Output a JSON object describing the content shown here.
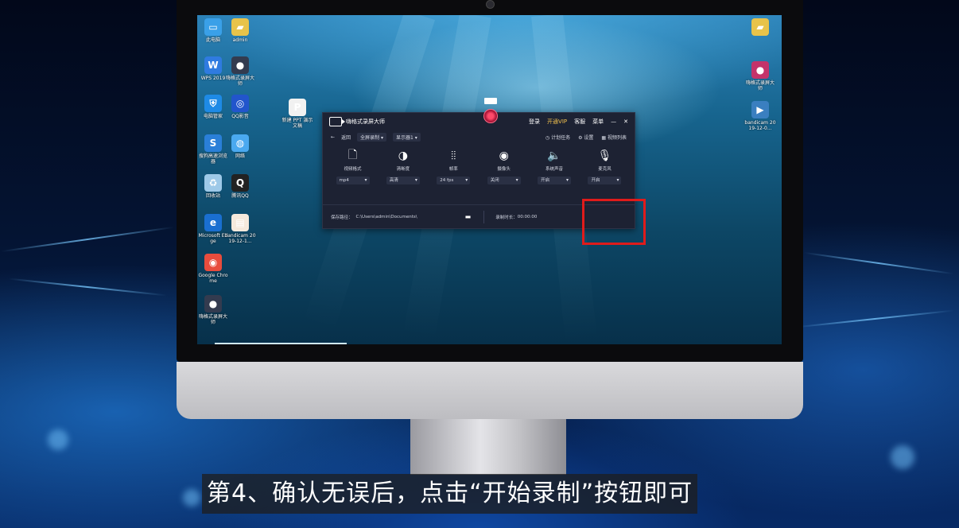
{
  "desktop_icons": [
    {
      "label": "此电脑",
      "icon": "computer-icon",
      "color": "#3aa0e8"
    },
    {
      "label": "admin",
      "icon": "user-folder-icon",
      "color": "#e8c34a"
    },
    {
      "label": "WPS 2019",
      "icon": "wps-icon",
      "color": "#2f7be0"
    },
    {
      "label": "嗨格式录屏大师",
      "icon": "recorder-icon",
      "color": "#333b4f"
    },
    {
      "label": "电脑管家",
      "icon": "shield-icon",
      "color": "#1e8ae6"
    },
    {
      "label": "QQ影音",
      "icon": "media-player-icon",
      "color": "#2255cc"
    },
    {
      "label": "新建 PPT 演示文稿",
      "icon": "ppt-file-icon",
      "color": "#f1f1f1"
    },
    {
      "label": "搜狗高速浏览器",
      "icon": "browser-icon",
      "color": "#2a7fd8"
    },
    {
      "label": "网络",
      "icon": "network-icon",
      "color": "#4aa9f0"
    },
    {
      "label": "回收站",
      "icon": "recycle-bin-icon",
      "color": "#9ec9e8"
    },
    {
      "label": "腾讯QQ",
      "icon": "qq-icon",
      "color": "#222"
    },
    {
      "label": "Microsoft Edge",
      "icon": "edge-icon",
      "color": "#1a6fd0"
    },
    {
      "label": "bandicam 2019-12-1...",
      "icon": "image-file-icon",
      "color": "#f5e9dc"
    },
    {
      "label": "Google Chrome",
      "icon": "chrome-icon",
      "color": "#e84c3d"
    },
    {
      "label": "嗨格式录屏大师",
      "icon": "recorder-icon",
      "color": "#333b4f"
    },
    {
      "label": "",
      "icon": "folder-icon",
      "color": "#e8c34a"
    },
    {
      "label": "嗨格式录屏大师",
      "icon": "recorder-icon",
      "color": "#c4336a"
    },
    {
      "label": "bandicam 2019-12-0...",
      "icon": "video-file-icon",
      "color": "#3a7fc0"
    }
  ],
  "app": {
    "title": "嗨格式录屏大师",
    "login": "登录",
    "vip": "开通VIP",
    "service": "客服",
    "menu": "菜单",
    "minimize": "—",
    "close": "✕",
    "back": "返回",
    "mode": "全屏录制",
    "display": "显示器1",
    "schedule": "计划任务",
    "settings": "设置",
    "video_list": "视频列表",
    "features": [
      {
        "label": "视频格式",
        "value": "mp4",
        "icon": "file-icon"
      },
      {
        "label": "清晰度",
        "value": "高清",
        "icon": "contrast-icon"
      },
      {
        "label": "帧率",
        "value": "24 fps",
        "icon": "waveform-icon"
      },
      {
        "label": "摄像头",
        "value": "关闭",
        "icon": "camera-icon"
      },
      {
        "label": "系统声音",
        "value": "开启",
        "icon": "speaker-icon"
      },
      {
        "label": "麦克风",
        "value": "开启",
        "icon": "microphone-icon"
      }
    ],
    "save_path_label": "保存路径：",
    "save_path": "C:\\Users\\admin\\Documents\\",
    "duration_label": "录制时长：",
    "duration": "00:00:00"
  },
  "subtitle": "第4、确认无误后，点击“开始录制”按钮即可"
}
